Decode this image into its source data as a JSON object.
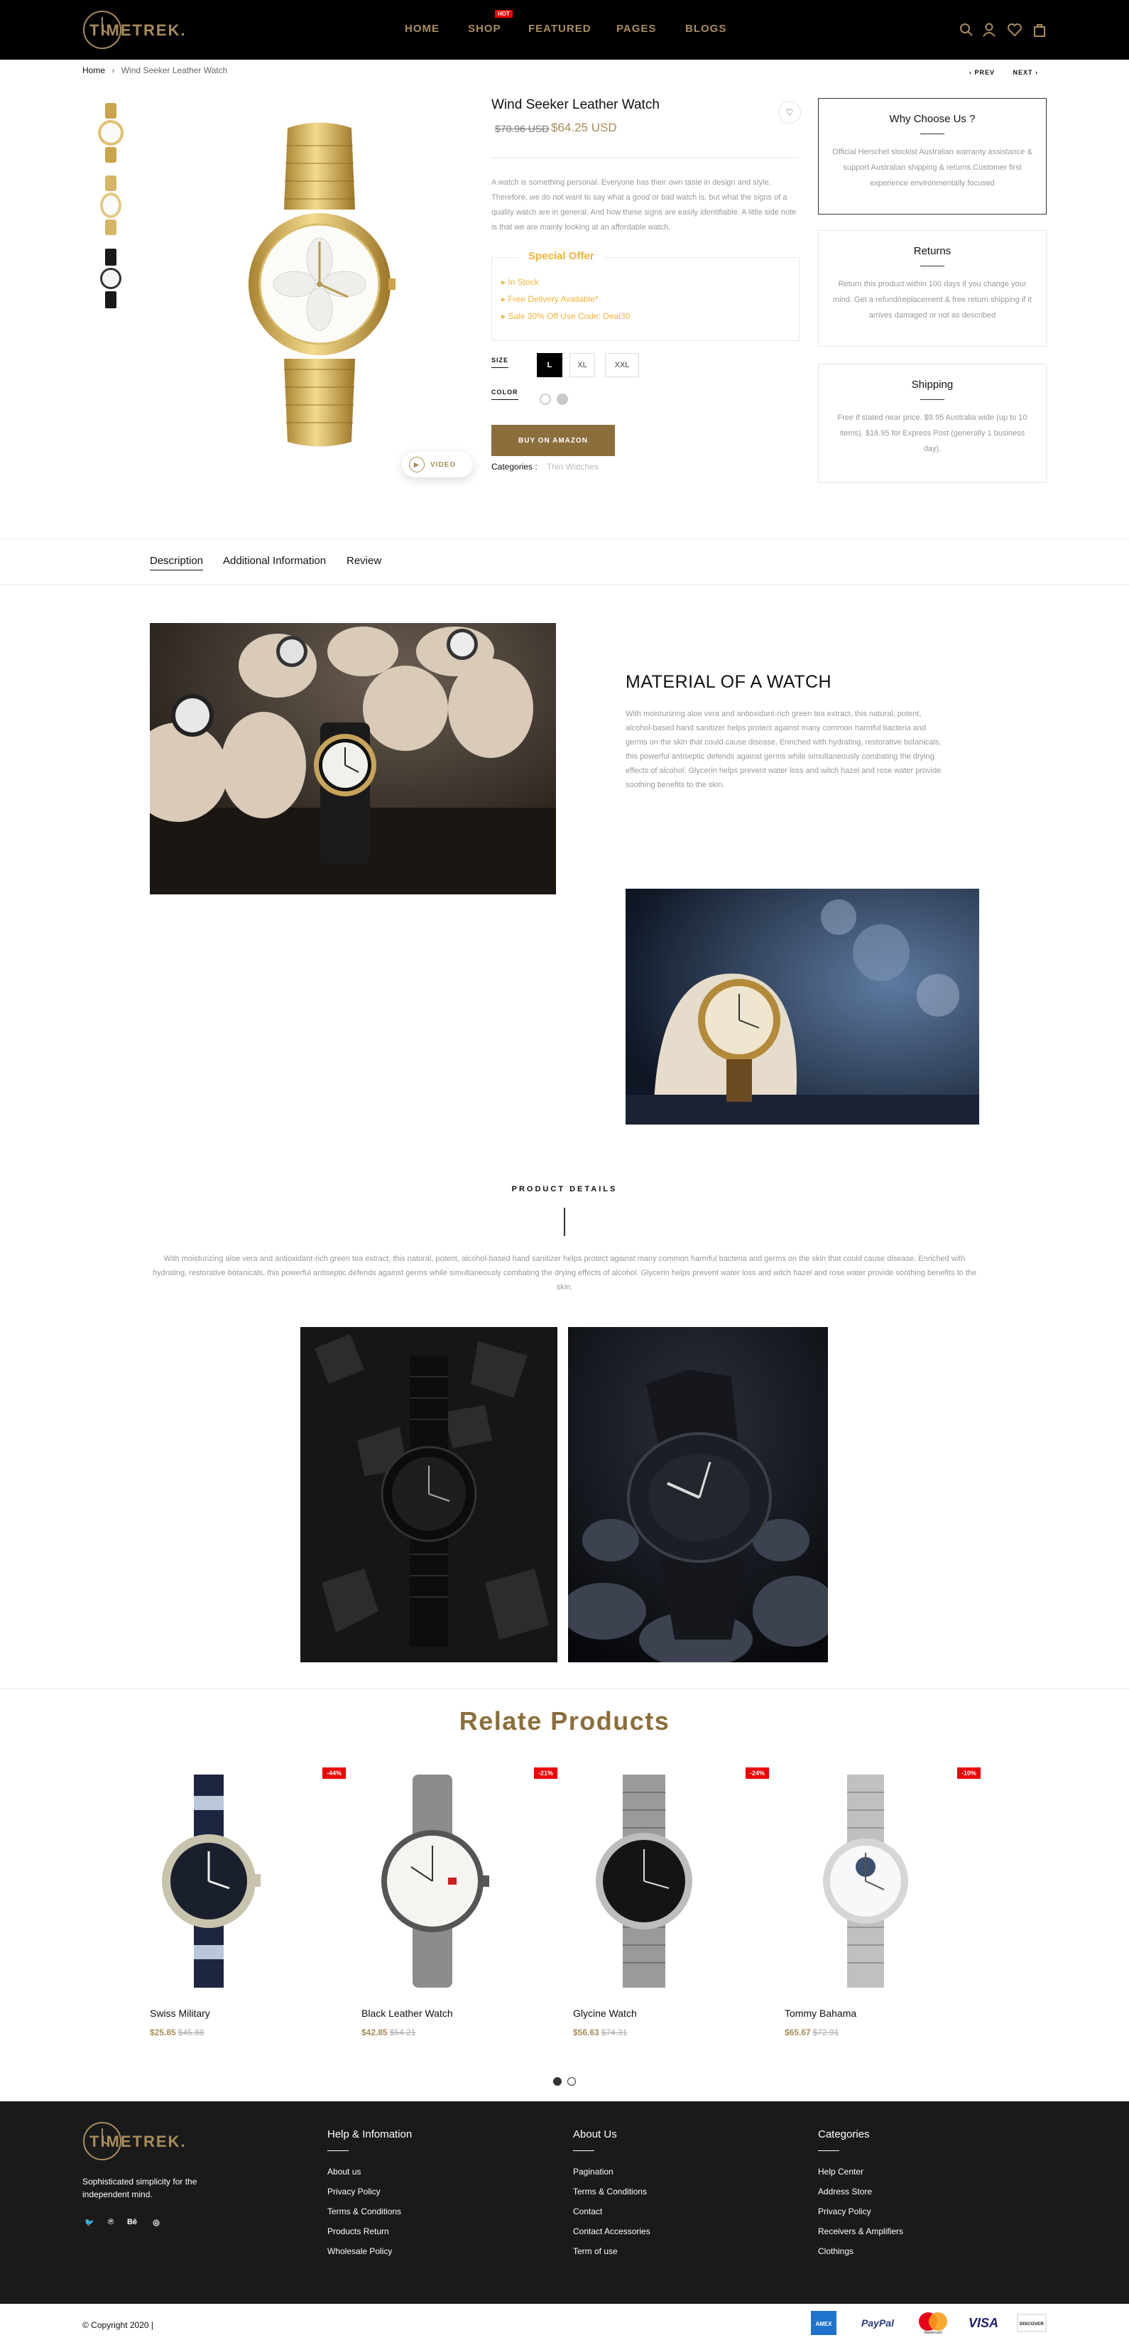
{
  "header": {
    "logo": "TIMETREK.",
    "nav": [
      "HOME",
      "SHOP",
      "FEATURED",
      "PAGES",
      "BLOGS"
    ],
    "hot_badge": "HOT",
    "icons": [
      "search-icon",
      "user-icon",
      "heart-icon",
      "bag-icon"
    ]
  },
  "breadcrumb": {
    "home": "Home",
    "sep": "›",
    "current": "Wind Seeker Leather Watch"
  },
  "pager": {
    "prev": "‹  PREV",
    "next": "NEXT  ›"
  },
  "product": {
    "title": "Wind Seeker Leather Watch",
    "old_price": "$70.96 USD",
    "new_price": "$64.25 USD",
    "description": "A watch is something personal. Everyone has their own taste in design and style. Therefore, we do not want to say what a good or bad watch is, but what the signs of a quality watch are in general. And how these signs are easily identifiable. A little side note is that we are mainly looking at an affordable watch.",
    "offer_title": "Special Offer",
    "offer_items": [
      "In Stock",
      "Free Delivery Available*",
      "Sale 30% Off Use Code: Deal30"
    ],
    "size_label": "SIZE",
    "sizes": [
      "L",
      "XL",
      "XXL"
    ],
    "selected_size": "L",
    "color_label": "COLOR",
    "colors": [
      "#ffffff",
      "#c8c8c8"
    ],
    "buy_label": "BUY ON AMAZON",
    "categories_label": "Categories :",
    "categories_value": "Thin Watches",
    "video_label": "VIDEO"
  },
  "sidebar": [
    {
      "title": "Why Choose Us ?",
      "text": "Official Herschel stockist Australian warranty assistance & support Australian shipping & returns.Customer first experience environmentally focused"
    },
    {
      "title": "Returns",
      "text": "Return this product within 100 days if you change your mind. Get a refund/replacement & free return shipping if it arrives damaged or not as described"
    },
    {
      "title": "Shipping",
      "text": "Free if stated near price. $9.95 Australia wide (up to 10 items). $18.95 for Express Post (generally 1 business day)."
    }
  ],
  "tabs": [
    "Description",
    "Additional Information",
    "Review"
  ],
  "material": {
    "title": "MATERIAL OF A WATCH",
    "text": "With moisturizing aloe vera and antioxidant-rich green tea extract, this natural, potent, alcohol-based hand sanitizer helps protect against many common harmful bacteria and germs on the skin that could cause disease. Enriched with hydrating, restorative botanicals, this powerful antiseptic defends against germs while simultaneously combating the drying effects of alcohol. Glycerin helps prevent water loss and witch hazel and rose water provide soothing benefits to the skin."
  },
  "product_details": {
    "heading": "PRODUCT DETAILS",
    "text": "With moisturizing aloe vera and antioxidant-rich green tea extract, this natural, potent, alcohol-based hand sanitizer helps protect against many common harmful bacteria and germs on the skin that could cause disease. Enriched with hydrating, restorative botanicals, this powerful antiseptic defends against germs while simultaneously combating the drying effects of alcohol. Glycerin helps prevent water loss and witch hazel and rose water provide soothing benefits to the skin."
  },
  "related": {
    "heading": "Relate Products",
    "items": [
      {
        "name": "Swiss Military",
        "price": "$25.85",
        "old": "$45.88",
        "badge": "-44%"
      },
      {
        "name": "Black Leather Watch",
        "price": "$42.85",
        "old": "$54.21",
        "badge": "-21%"
      },
      {
        "name": "Glycine Watch",
        "price": "$56.63",
        "old": "$74.31",
        "badge": "-24%"
      },
      {
        "name": "Tommy Bahama",
        "price": "$65.67",
        "old": "$72.91",
        "badge": "-10%"
      }
    ]
  },
  "footer": {
    "logo": "TIMETREK.",
    "tagline": "Sophisticated simplicity for the independent mind.",
    "social": [
      "twitter-icon",
      "pinterest-icon",
      "behance-icon",
      "instagram-icon"
    ],
    "cols": [
      {
        "title": "Help & Infomation",
        "links": [
          "About us",
          "Privacy Policy",
          "Terms & Conditions",
          "Products Return",
          "Wholesale Policy"
        ]
      },
      {
        "title": "About Us",
        "links": [
          "Pagination",
          "Terms & Conditions",
          "Contact",
          "Contact Accessories",
          "Term of use"
        ]
      },
      {
        "title": "Categories",
        "links": [
          "Help Center",
          "Address Store",
          "Privacy Policy",
          "Receivers & Amplifiers",
          "Clothings"
        ]
      }
    ],
    "copyright": "© Copyright 2020 |",
    "payments": [
      "AMEX",
      "PayPal",
      "Mastercard",
      "VISA",
      "DISCOVER"
    ]
  }
}
